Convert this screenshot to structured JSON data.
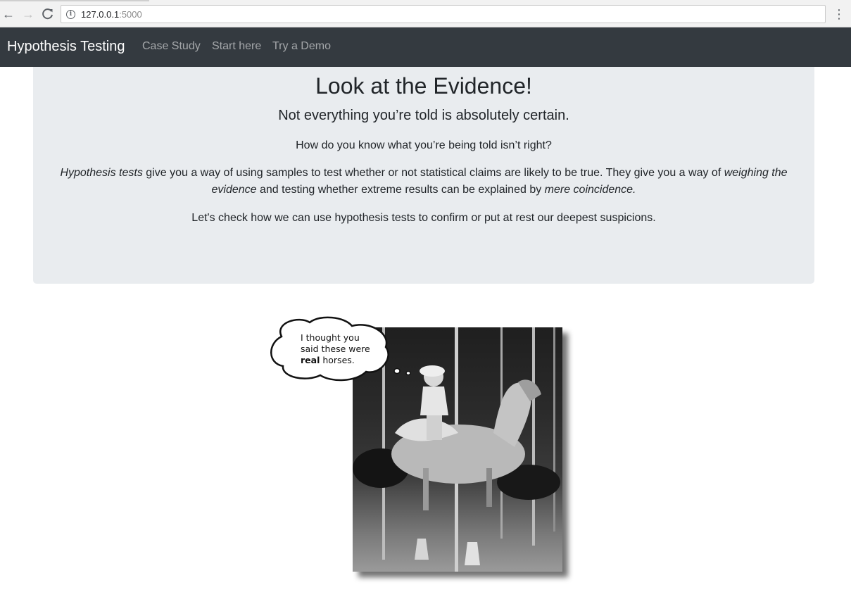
{
  "browser": {
    "url_host": "127.0.0.1",
    "url_port": ":5000",
    "back_glyph": "←",
    "forward_glyph": "→",
    "reload_glyph": "C",
    "menu_glyph": "⋮"
  },
  "navbar": {
    "brand": "Hypothesis Testing",
    "links": [
      "Case Study",
      "Start here",
      "Try a Demo"
    ]
  },
  "jumbotron": {
    "title": "Look at the Evidence!",
    "lead": "Not everything you’re told is absolutely certain.",
    "question": "How do you know what you’re being told isn’t right?",
    "para_em1": "Hypothesis tests",
    "para_text1": " give you a way of using samples to test whether or not statistical claims are likely to be true. They give you a way of ",
    "para_em2": "weighing the evidence",
    "para_text2": " and testing whether extreme results can be explained by ",
    "para_em3": "mere coincidence.",
    "closing": "Let's check how we can use hypothesis tests to confirm or put at rest our deepest suspicions."
  },
  "illustration": {
    "bubble_line1": "I thought you",
    "bubble_line2": "said these were",
    "bubble_bold": "real",
    "bubble_rest": " horses."
  },
  "colors": {
    "navbar_bg": "#343a40",
    "jumbotron_bg": "#e9ecef"
  }
}
